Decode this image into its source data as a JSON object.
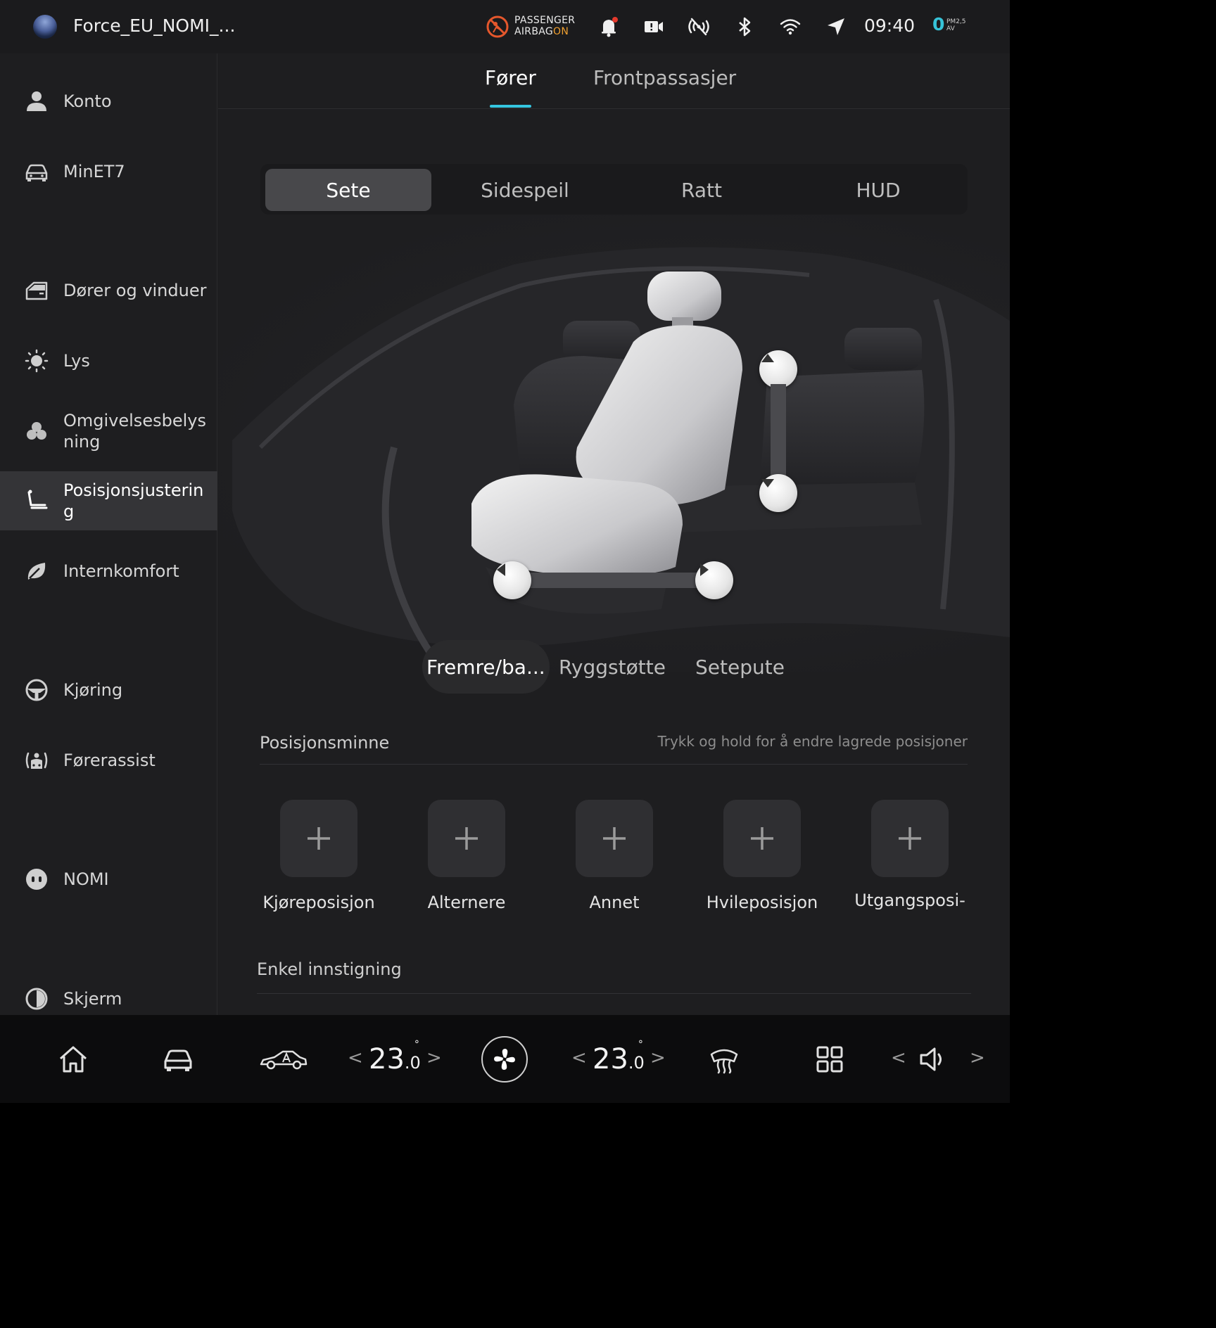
{
  "status_bar": {
    "profile_name": "Force_EU_NOMI_...",
    "airbag_line1": "PASSENGER",
    "airbag_line2": "AIRBAG",
    "airbag_state": "ON",
    "clock": "09:40",
    "pm_value": "0",
    "pm_label_line1": "PM2,5",
    "pm_label_line2": "AV",
    "icons": [
      "airbag-warning-icon",
      "notification-bell-icon",
      "dashcam-icon",
      "signal-off-icon",
      "bluetooth-icon",
      "wifi-icon",
      "location-arrow-icon"
    ]
  },
  "sidebar": {
    "items": [
      {
        "label": "Konto",
        "icon": "account-icon"
      },
      {
        "label": "MinET7",
        "icon": "car-icon"
      },
      {
        "label": "Dører og vinduer",
        "icon": "door-icon"
      },
      {
        "label": "Lys",
        "icon": "light-icon"
      },
      {
        "label": "Omgivelsesbelysning",
        "icon": "ambient-light-icon"
      },
      {
        "label": "Posisjonsjustering",
        "icon": "seat-icon"
      },
      {
        "label": "Internkomfort",
        "icon": "leaf-icon"
      },
      {
        "label": "Kjøring",
        "icon": "steering-wheel-icon"
      },
      {
        "label": "Førerassist",
        "icon": "driver-assist-icon"
      },
      {
        "label": "NOMI",
        "icon": "nomi-icon"
      },
      {
        "label": "Skjerm",
        "icon": "display-icon"
      }
    ],
    "active_index": 5
  },
  "tabs": {
    "items": [
      "Fører",
      "Frontpassasjer"
    ],
    "active_index": 0
  },
  "segment": {
    "items": [
      "Sete",
      "Sidespeil",
      "Ratt",
      "HUD"
    ],
    "active_index": 0
  },
  "seat_subtabs": {
    "items": [
      "Fremre/ba...",
      "Ryggstøtte",
      "Setepute"
    ],
    "active_index": 0
  },
  "position_memory": {
    "title": "Posisjonsminne",
    "hint": "Trykk og hold for å endre lagrede posisjoner",
    "slots": [
      "Kjøreposisjon",
      "Alternere",
      "Annet",
      "Hvileposisjon",
      "Utgangsposi-"
    ]
  },
  "easy_entry": {
    "title": "Enkel innstigning"
  },
  "dock": {
    "left_temp": "23",
    "left_temp_decimal": ".0",
    "right_temp": "23",
    "right_temp_decimal": ".0",
    "degree_symbol": "°",
    "chevron_left": "<",
    "chevron_right": ">",
    "icons": [
      "home-icon",
      "car-front-icon",
      "car-side-icon",
      "fan-icon",
      "rear-defrost-icon",
      "apps-grid-icon",
      "volume-icon"
    ]
  },
  "colors": {
    "accent": "#35c6e0",
    "airbag_on": "#f0a030",
    "airbag_icon": "#e5572c"
  }
}
